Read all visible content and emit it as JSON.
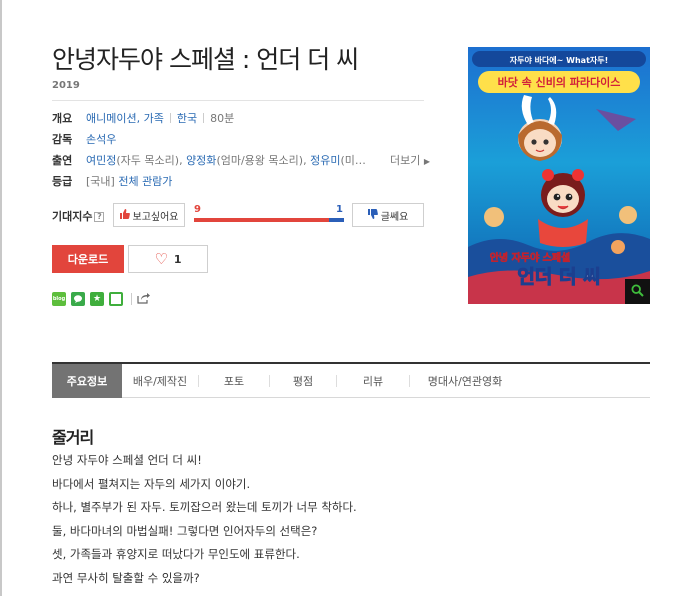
{
  "movie": {
    "title": "안녕자두야 스페셜 : 언더 더 씨",
    "year": "2019"
  },
  "info": {
    "overview_label": "개요",
    "genre": "애니메이션, 가족",
    "country": "한국",
    "runtime": "80분",
    "director_label": "감독",
    "director": "손석우",
    "cast_label": "출연",
    "cast": [
      {
        "name": "여민정",
        "role": "(자두 목소리)"
      },
      {
        "name": "양정화",
        "role": "(엄마/용왕 목소리)"
      },
      {
        "name": "정유미",
        "role": "(미…"
      }
    ],
    "cast_separator": ",",
    "more_label": "더보기",
    "rating_label": "등급",
    "rating_region": "[국내]",
    "rating_value": "전체 관람가"
  },
  "expectation": {
    "label": "기대지수",
    "help": "?",
    "want_label": "보고싶어요",
    "notwant_label": "글쎄요",
    "want_count": "9",
    "notwant_count": "1",
    "want_ratio": 0.9
  },
  "actions": {
    "download_label": "다운로드",
    "like_count": "1"
  },
  "share": {
    "icons": [
      "blog-icon",
      "talk-icon",
      "star-icon",
      "square-icon",
      "share-icon"
    ],
    "blog_text": "blog"
  },
  "poster": {
    "top_banner": "자두야 바다에~ What자두!",
    "headline": "바닷 속 신비의 파라다이스",
    "logo_small": "안녕 자두야 스페셜",
    "logo_big": "언더 더 씨"
  },
  "tabs": [
    {
      "label": "주요정보",
      "active": true
    },
    {
      "label": "배우/제작진",
      "active": false
    },
    {
      "label": "포토",
      "active": false
    },
    {
      "label": "평점",
      "active": false
    },
    {
      "label": "리뷰",
      "active": false
    },
    {
      "label": "명대사/연관영화",
      "active": false
    }
  ],
  "synopsis": {
    "title": "줄거리",
    "lines": [
      "안녕 자두야 스페셜 언더 더 씨!",
      " 바다에서 펼쳐지는 자두의 세가지 이야기.",
      " 하나, 별주부가 된 자두. 토끼잡으러 왔는데 토끼가 너무 착하다.",
      " 둘, 바다마녀의 마법실패! 그렇다면 인어자두의 선택은?",
      " 셋, 가족들과 휴양지로 떠났다가 무인도에 표류한다.",
      " 과연 무사히 탈출할 수 있을까?"
    ]
  },
  "colors": {
    "accent_red": "#e2453c",
    "accent_blue": "#2b5fb8",
    "link_blue": "#2a6ab3",
    "tab_active_bg": "#737373",
    "share_green": "#3fae3c"
  }
}
